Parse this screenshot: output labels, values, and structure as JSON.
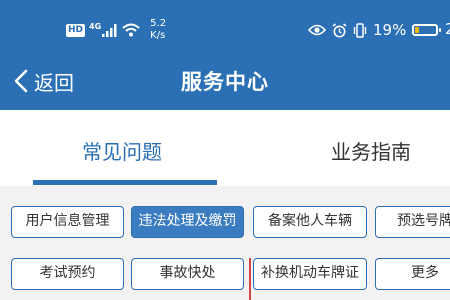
{
  "status_bar": {
    "hd": "HD",
    "network": "4G",
    "speed_value": "5.2",
    "speed_unit": "K/s",
    "battery_percent": "19%",
    "battery_level": 0.19,
    "time_partial": "2"
  },
  "nav": {
    "back_label": "返回",
    "title": "服务中心"
  },
  "tabs": [
    {
      "label": "常见问题",
      "active": true
    },
    {
      "label": "业务指南",
      "active": false
    }
  ],
  "chips": [
    {
      "label": "用户信息管理",
      "active": false
    },
    {
      "label": "违法处理及缴罚",
      "active": true
    },
    {
      "label": "备案他人车辆",
      "active": false
    },
    {
      "label": "预选号牌",
      "active": false
    },
    {
      "label": "考试预约",
      "active": false
    },
    {
      "label": "事故快处",
      "active": false
    },
    {
      "label": "补换机动车牌证",
      "active": false
    },
    {
      "label": "更多",
      "active": false
    }
  ],
  "colors": {
    "primary": "#2b6fb5",
    "chip_active": "#3b7cc0",
    "battery": "#f5b800",
    "marker_line": "#d64545"
  }
}
